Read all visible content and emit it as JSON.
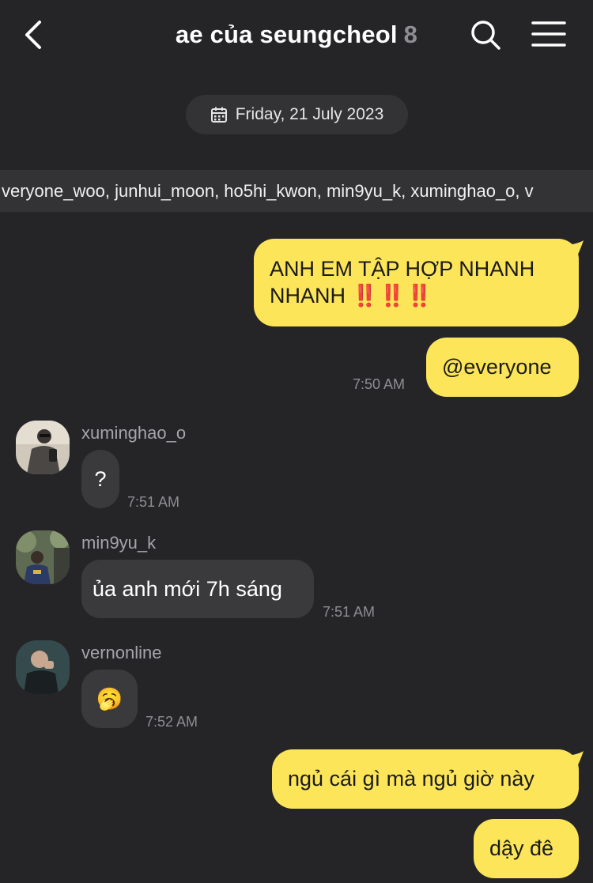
{
  "header": {
    "title": "ae của seungcheol",
    "member_count": "8",
    "back_icon": "chevron-left-icon",
    "search_icon": "search-icon",
    "menu_icon": "hamburger-menu-icon"
  },
  "date_divider": {
    "icon": "calendar-icon",
    "text": "Friday, 21 July 2023"
  },
  "mention_bar": {
    "text": "veryone_woo, junhui_moon, ho5hi_kwon, min9yu_k, xuminghao_o, v"
  },
  "messages": [
    {
      "direction": "outgoing",
      "text": "ANH EM TẬP HỢP NHANH NHANH",
      "emphasis": "‼️‼️‼️"
    },
    {
      "direction": "outgoing",
      "text": "@everyone",
      "time": "7:50 AM"
    },
    {
      "direction": "incoming",
      "sender": "xuminghao_o",
      "text": "?",
      "time": "7:51 AM"
    },
    {
      "direction": "incoming",
      "sender": "min9yu_k",
      "text": "ủa anh mới 7h sáng",
      "time": "7:51 AM"
    },
    {
      "direction": "incoming",
      "sender": "vernonline",
      "text": "🥱",
      "time": "7:52 AM"
    },
    {
      "direction": "outgoing",
      "text": "ngủ cái gì mà ngủ giờ này"
    },
    {
      "direction": "outgoing",
      "text": "dậy đê"
    }
  ],
  "colors": {
    "background": "#252527",
    "outgoing_bubble": "#fde55a",
    "incoming_bubble": "#3a3a3d",
    "timestamp": "#8e8e93"
  }
}
